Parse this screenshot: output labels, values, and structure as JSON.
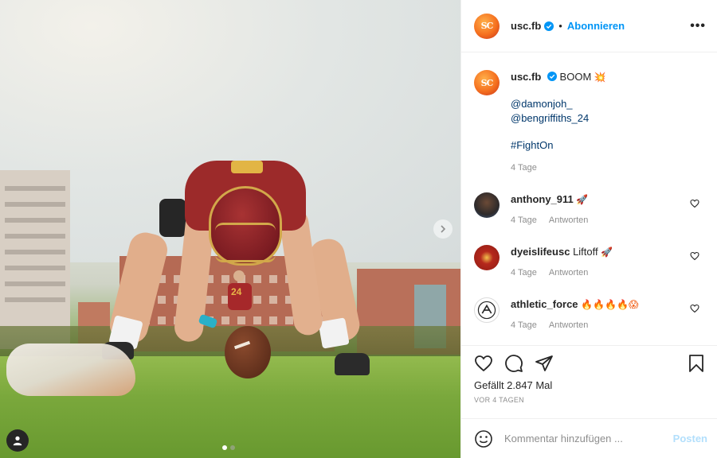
{
  "post": {
    "author": {
      "username": "usc.fb",
      "avatar_text": "SC",
      "separator": "•",
      "follow_label": "Abonnieren",
      "more_label": "•••"
    },
    "media": {
      "jersey_number": "24",
      "carousel_pages": 2,
      "carousel_active_index": 0
    },
    "caption": {
      "username": "usc.fb",
      "text": "BOOM",
      "emoji": "💥",
      "mentions": [
        "@damonjoh_",
        "@bengriffiths_24"
      ],
      "hashtag": "#FightOn",
      "age": "4 Tage"
    },
    "comments": [
      {
        "username": "anthony_911",
        "text": "",
        "emoji": "🚀",
        "age": "4 Tage",
        "reply_label": "Antworten",
        "avatar_color": "#2e4a6e"
      },
      {
        "username": "dyeislifeusc",
        "text": "Liftoff",
        "emoji": "🚀",
        "age": "4 Tage",
        "reply_label": "Antworten",
        "avatar_color": "#b5281c"
      },
      {
        "username": "athletic_force",
        "text": "",
        "emoji": "🔥🔥🔥🔥😱",
        "age": "4 Tage",
        "reply_label": "Antworten",
        "avatar_color": "#ffffff"
      }
    ],
    "likes_text": "Gefällt 2.847 Mal",
    "timestamp": "VOR 4 TAGEN",
    "composer": {
      "placeholder": "Kommentar hinzufügen ...",
      "post_label": "Posten"
    }
  },
  "colors": {
    "accent_blue": "#0095f6",
    "link_blue": "#00376b",
    "muted_text": "#8e8e8e",
    "post_disabled": "#b2dffc",
    "brand_orange": "#f5701f"
  },
  "icons": {
    "verified": "verified-badge-icon",
    "like": "heart-icon",
    "comment": "comment-bubble-icon",
    "share": "paper-plane-icon",
    "save": "bookmark-icon",
    "emoji": "smiley-icon",
    "next": "chevron-right-icon",
    "tags": "user-tag-icon"
  }
}
